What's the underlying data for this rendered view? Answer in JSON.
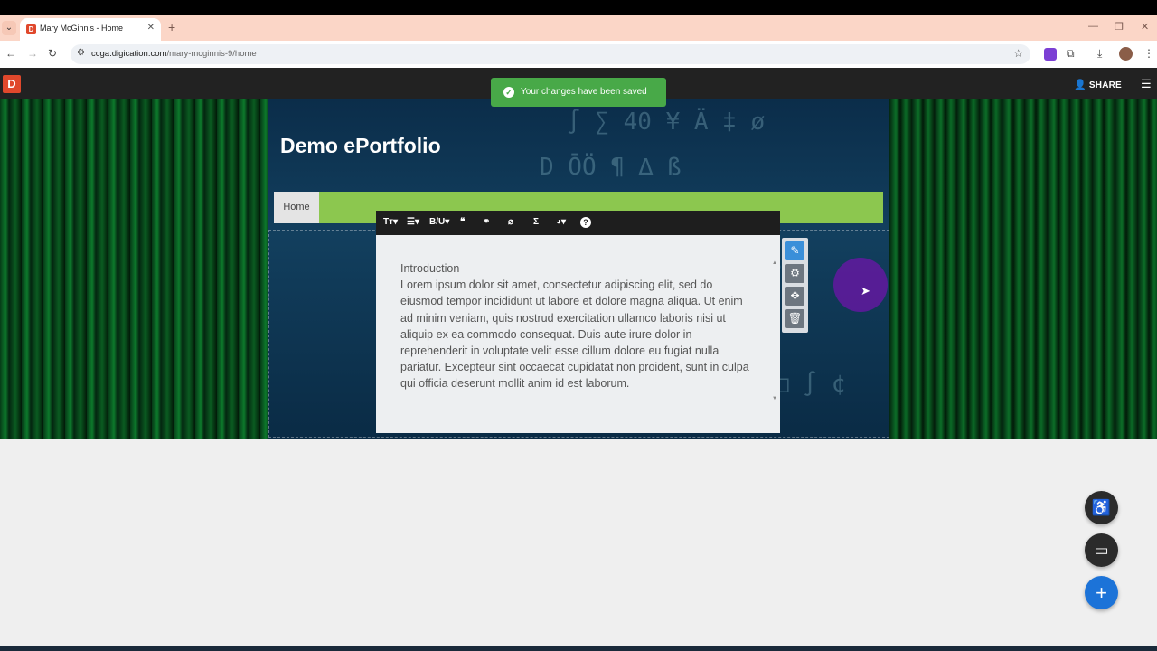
{
  "browser": {
    "tab_title": "Mary McGinnis - Home",
    "tab_favicon_letter": "D",
    "url_domain": "ccga.digication.com",
    "url_path": "/mary-mcginnis-9/home"
  },
  "app": {
    "logo_letter": "D",
    "share_label": "SHARE",
    "toast_message": "Your changes have been saved"
  },
  "site": {
    "title": "Demo ePortfolio",
    "nav_home": "Home"
  },
  "editor": {
    "toolbar": [
      "Tт",
      "☰",
      "B/U",
      "❝",
      "🔗",
      "📎",
      "Σ",
      "🎨",
      "?"
    ],
    "heading": "Introduction",
    "body": "Lorem ipsum dolor sit amet, consectetur adipiscing elit, sed do eiusmod tempor incididunt ut labore et dolore magna aliqua. Ut enim ad minim veniam, quis nostrud exercitation ullamco laboris nisi ut aliquip ex ea commodo consequat. Duis aute irure dolor in reprehenderit in voluptate velit esse cillum dolore eu fugiat nulla pariatur. Excepteur sint occaecat cupidatat non proident, sunt in culpa qui officia deserunt mollit anim id est laborum."
  },
  "icons": {
    "edit": "edit-icon",
    "settings": "gear-icon",
    "move": "move-icon",
    "delete": "trash-icon",
    "accessibility": "accessibility-icon",
    "chat": "chat-icon",
    "add": "plus-icon"
  },
  "colors": {
    "brand": "#e0482c",
    "nav_green": "#8cc74f",
    "toast_green": "#48a948",
    "fab_blue": "#1c73d8",
    "edit_active": "#3a8fd9"
  }
}
